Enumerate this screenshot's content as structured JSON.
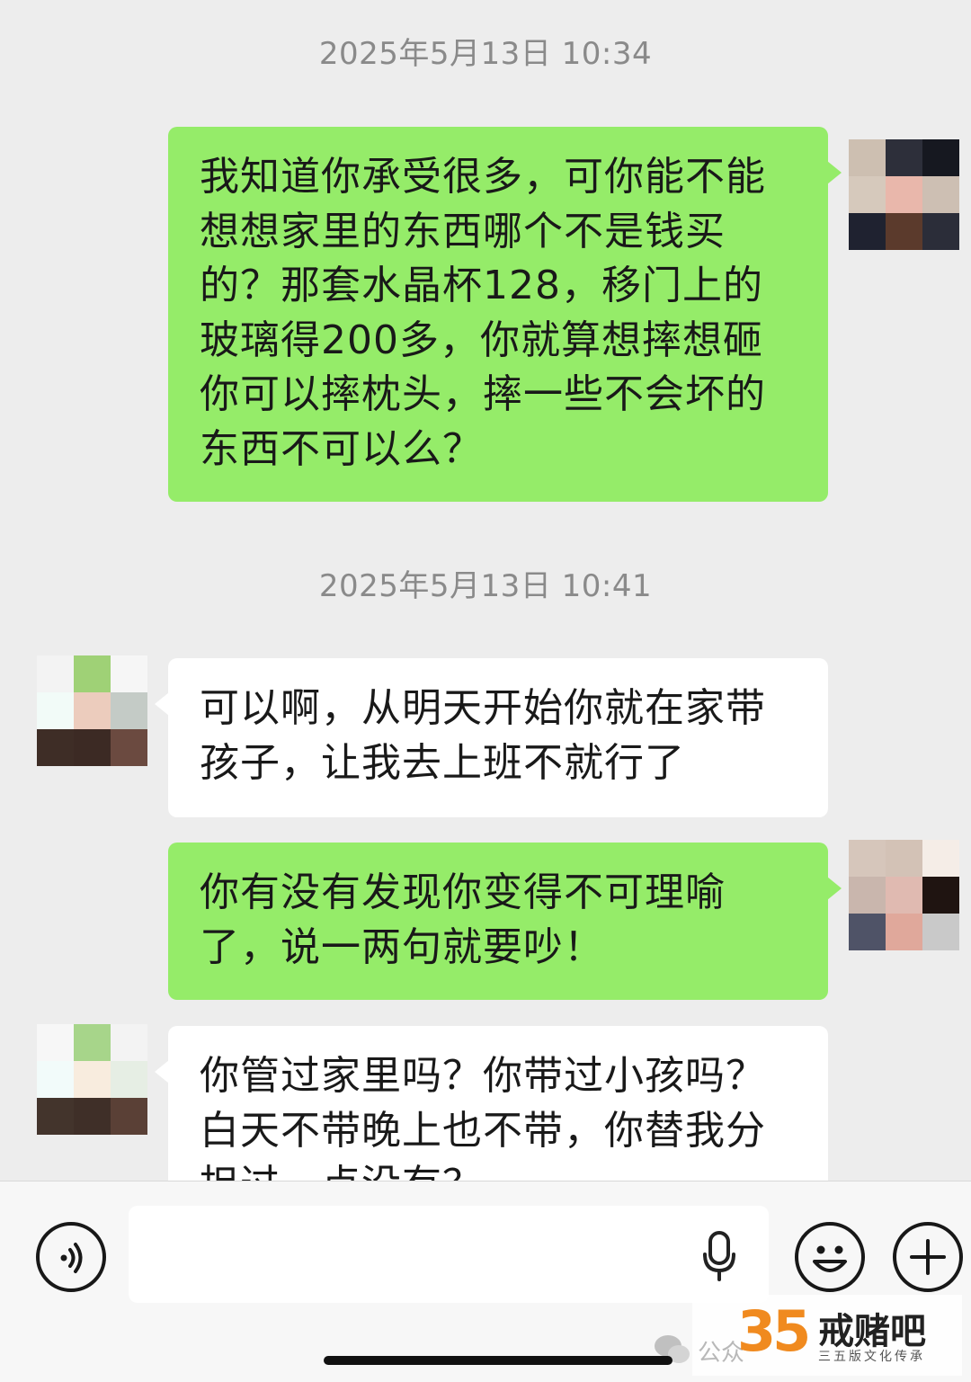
{
  "timestamps": [
    "2025年5月13日 10:34",
    "2025年5月13日 10:41"
  ],
  "messages": [
    {
      "sender": "me",
      "text": "我知道你承受很多，可你能不能想想家里的东西哪个不是钱买的？那套水晶杯128，移门上的玻璃得200多，你就算想摔想砸你可以摔枕头，摔一些不会坏的东西不可以么？"
    },
    {
      "sender": "other",
      "text": "可以啊，从明天开始你就在家带孩子，让我去上班不就行了"
    },
    {
      "sender": "me",
      "text": "你有没有发现你变得不可理喻了，说一两句就要吵！"
    },
    {
      "sender": "other",
      "text": "你管过家里吗？你带过小孩吗？白天不带晚上也不带，你替我分担过一点没有？"
    }
  ],
  "avatars": {
    "me_a": [
      "#cdbfb1",
      "#2d2f3a",
      "#161820",
      "#d6c9bc",
      "#e9b7ab",
      "#cdbfb3",
      "#1f2230",
      "#5b3a2c",
      "#2b2d39"
    ],
    "other_a": [
      "#f3f3f3",
      "#9fd176",
      "#f6f6f6",
      "#f2fbf8",
      "#ecccbd",
      "#c4cbc6",
      "#3e2d26",
      "#3c2a24",
      "#6b4a40"
    ],
    "me_b": [
      "#d6c6bb",
      "#d3c2b6",
      "#f5ede7",
      "#c9b6ad",
      "#e0bab1",
      "#1f1411",
      "#4f5367",
      "#e0a89b",
      "#c9c9c9"
    ],
    "other_b": [
      "#f7f7f7",
      "#a7d58a",
      "#f3f3f3",
      "#f2fbfa",
      "#f8ecde",
      "#e6eee4",
      "#43342c",
      "#3f2f28",
      "#5a4036"
    ]
  },
  "toolbar": {
    "voice_icon": "voice-toggle-icon",
    "mic_icon": "microphone-icon",
    "emoji_icon": "emoji-icon",
    "plus_icon": "plus-icon",
    "input_value": ""
  },
  "watermark": {
    "number": "35",
    "title": "戒赌吧",
    "subtitle": "三五版文化传承",
    "left_text": "公众"
  }
}
